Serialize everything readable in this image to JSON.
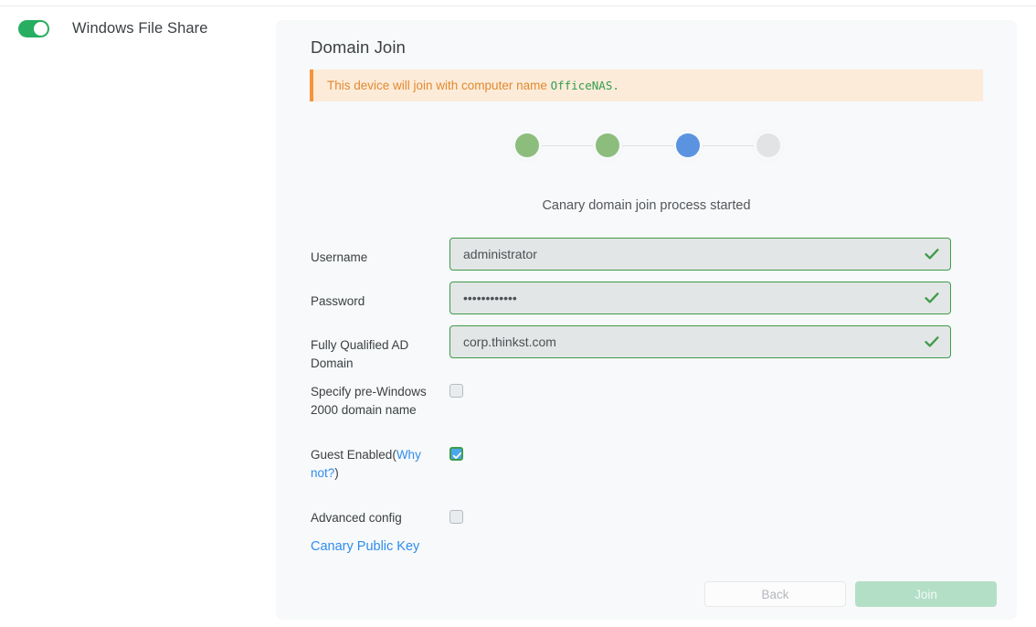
{
  "service": {
    "label": "Windows File Share",
    "enabled": true,
    "toggle_color": "#27ae60"
  },
  "panel": {
    "title": "Domain Join",
    "alert": {
      "prefix": "This device will join with computer name ",
      "computer_name": "OfficeNAS",
      "suffix": ".",
      "accent_color": "#f5943b",
      "text_color": "#e08a2e",
      "background": "#fdebd9",
      "mono_color": "#2f9e4f"
    },
    "steps": [
      {
        "name": "step-1",
        "state": "done",
        "color": "#8cbd7d"
      },
      {
        "name": "step-2",
        "state": "done",
        "color": "#8cbd7d"
      },
      {
        "name": "step-3",
        "state": "active",
        "color": "#5b93e0"
      },
      {
        "name": "step-4",
        "state": "todo",
        "color": "#e2e3e4"
      }
    ],
    "status_text": "Canary domain join process started",
    "fields": [
      {
        "label": "Username",
        "value": "administrator",
        "placeholder": "Username",
        "valid": true
      },
      {
        "label": "Password",
        "value": "••••••••••••",
        "placeholder": "Password",
        "valid": true
      },
      {
        "label": "Fully Qualified AD Domain",
        "value": "corp.thinkst.com",
        "placeholder": "Fully Qualified AD Domain",
        "valid": true
      }
    ],
    "checkboxes": [
      {
        "label": "Specify pre-Windows 2000 domain name",
        "checked": false,
        "link_text": "",
        "has_link": false
      },
      {
        "label": "Guest Enabled",
        "checked": true,
        "link_text": "Why not?",
        "has_link": true,
        "link_open": "(",
        "link_close": ")"
      },
      {
        "label": "Advanced config",
        "checked": false,
        "link_text": "",
        "has_link": false
      }
    ],
    "public_key_link": "Canary Public Key",
    "buttons": {
      "back": "Back",
      "join": "Join",
      "back_disabled": true,
      "join_disabled": true,
      "join_color": "#b4dfc7"
    }
  }
}
